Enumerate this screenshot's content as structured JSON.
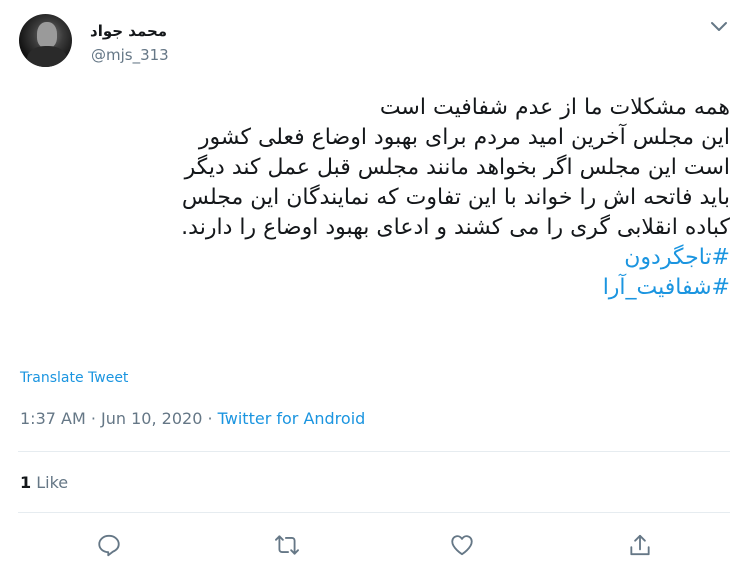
{
  "author": {
    "display_name": "محمد جواد",
    "handle": "@mjs_313"
  },
  "tweet": {
    "lines": [
      "همه مشکلات ما از عدم شفافیت است",
      "این مجلس آخرین امید مردم برای بهبود اوضاع فعلی کشور",
      "است این مجلس اگر بخواهد مانند مجلس قبل عمل کند دیگر",
      "باید فاتحه اش را خواند با این تفاوت که نمایندگان این مجلس",
      "کباده انقلابی گری را می کشند و ادعای بهبود اوضاع را دارند."
    ],
    "hashtags": [
      "#تاجگردون",
      "#شفافیت_آرا"
    ]
  },
  "translate_label": "Translate Tweet",
  "meta": {
    "time": "1:37 AM",
    "separator1": " · ",
    "date": "Jun 10, 2020",
    "separator2": " · ",
    "source": "Twitter for Android"
  },
  "stats": {
    "likes_count": "1",
    "likes_label": "Like"
  },
  "icons": {
    "menu": "chevron-down-icon",
    "reply": "reply-icon",
    "retweet": "retweet-icon",
    "like": "heart-icon",
    "share": "share-icon"
  },
  "colors": {
    "link": "#1b95e0",
    "muted": "#657786",
    "text": "#14171a"
  }
}
